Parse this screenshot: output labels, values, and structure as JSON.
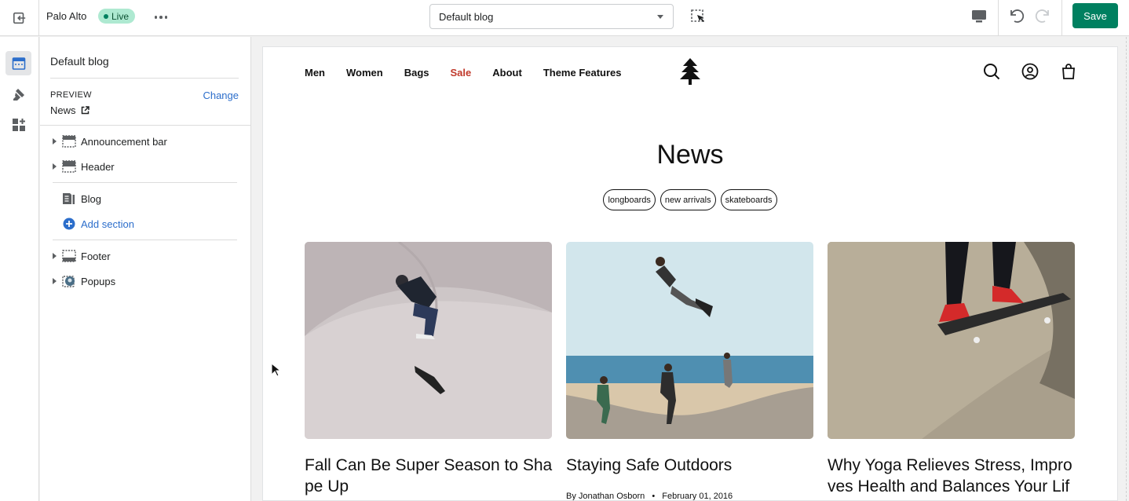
{
  "topbar": {
    "theme_name": "Palo Alto",
    "status": "Live",
    "template_select": "Default blog",
    "save_label": "Save"
  },
  "sidebar": {
    "title": "Default blog",
    "preview_label": "PREVIEW",
    "change_label": "Change",
    "preview_value": "News",
    "sections": [
      {
        "label": "Announcement bar",
        "icon": "announcement-bar-icon"
      },
      {
        "label": "Header",
        "icon": "header-icon"
      },
      {
        "label": "Blog",
        "icon": "blog-icon"
      },
      {
        "label": "Add section",
        "icon": "add-circle-icon"
      },
      {
        "label": "Footer",
        "icon": "footer-icon"
      },
      {
        "label": "Popups",
        "icon": "popups-icon"
      }
    ]
  },
  "store": {
    "nav": [
      "Men",
      "Women",
      "Bags",
      "Sale",
      "About",
      "Theme Features"
    ],
    "sale_color": "#c0392b",
    "blog_title": "News",
    "tags": [
      "longboards",
      "new arrivals",
      "skateboards"
    ],
    "articles": [
      {
        "title": "Fall Can Be Super Season to Shape Up",
        "meta": ""
      },
      {
        "title": "Staying Safe Outdoors",
        "author": "By Jonathan Osborn",
        "date": "February 01, 2016"
      },
      {
        "title": "Why Yoga Relieves Stress, Improves Health and Balances Your Lif",
        "meta": ""
      }
    ]
  },
  "colors": {
    "accent": "#008060",
    "link": "#2c6ecb",
    "live_badge": "#aee9d1"
  }
}
